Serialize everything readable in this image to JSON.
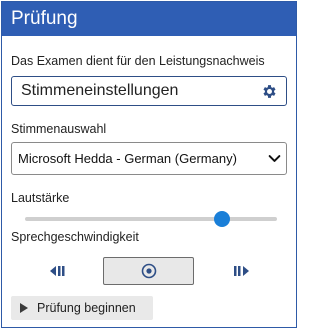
{
  "header": {
    "title": "Prüfung"
  },
  "exam": {
    "description": "Das Examen dient für den Leistungsnachweis",
    "settings_field_value": "Stimmeneinstellungen"
  },
  "voice": {
    "label": "Stimmenauswahl",
    "selected": "Microsoft Hedda - German (Germany)"
  },
  "volume": {
    "label": "Lautstärke",
    "level_fraction": 0.78
  },
  "speed": {
    "label": "Sprechgeschwindigkeit"
  },
  "controls": {
    "prev_icon": "skip-back-icon",
    "stop_icon": "stop-circle-icon",
    "next_icon": "skip-forward-icon"
  },
  "start_button": {
    "label": "Prüfung beginnen"
  },
  "colors": {
    "header_bg": "#2f5eb4",
    "accent": "#1a7fd8",
    "icon": "#2e4e86"
  }
}
